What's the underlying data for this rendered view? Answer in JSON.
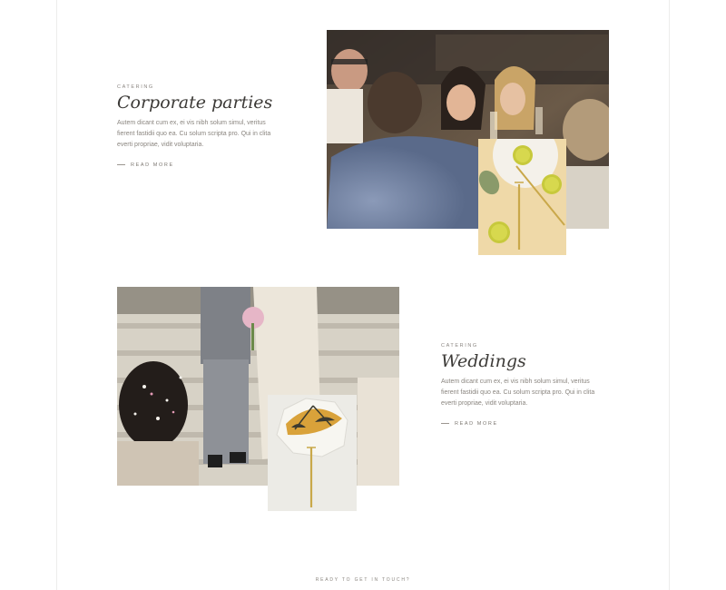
{
  "sections": [
    {
      "eyebrow": "CATERING",
      "title": "Corporate parties",
      "body": [
        "Autem dicant cum ex, ei vis nibh solum simul, veritus",
        "fierent fastidii quo ea. Cu solum scripta pro. Qui in clita",
        "everti propriae, vidit voluptaria."
      ],
      "read_more": "READ MORE"
    },
    {
      "eyebrow": "CATERING",
      "title": "Weddings",
      "body": [
        "Autem dicant cum ex, ei vis nibh solum simul, veritus",
        "fierent fastidii quo ea. Cu solum scripta pro. Qui in clita",
        "everti propriae, vidit voluptaria."
      ],
      "read_more": "READ MORE"
    }
  ],
  "footer": {
    "eyebrow": "READY TO GET IN TOUCH?"
  },
  "colors": {
    "heading": "#3c3a37",
    "body": "#8a857f",
    "divider": "#ededeb"
  }
}
